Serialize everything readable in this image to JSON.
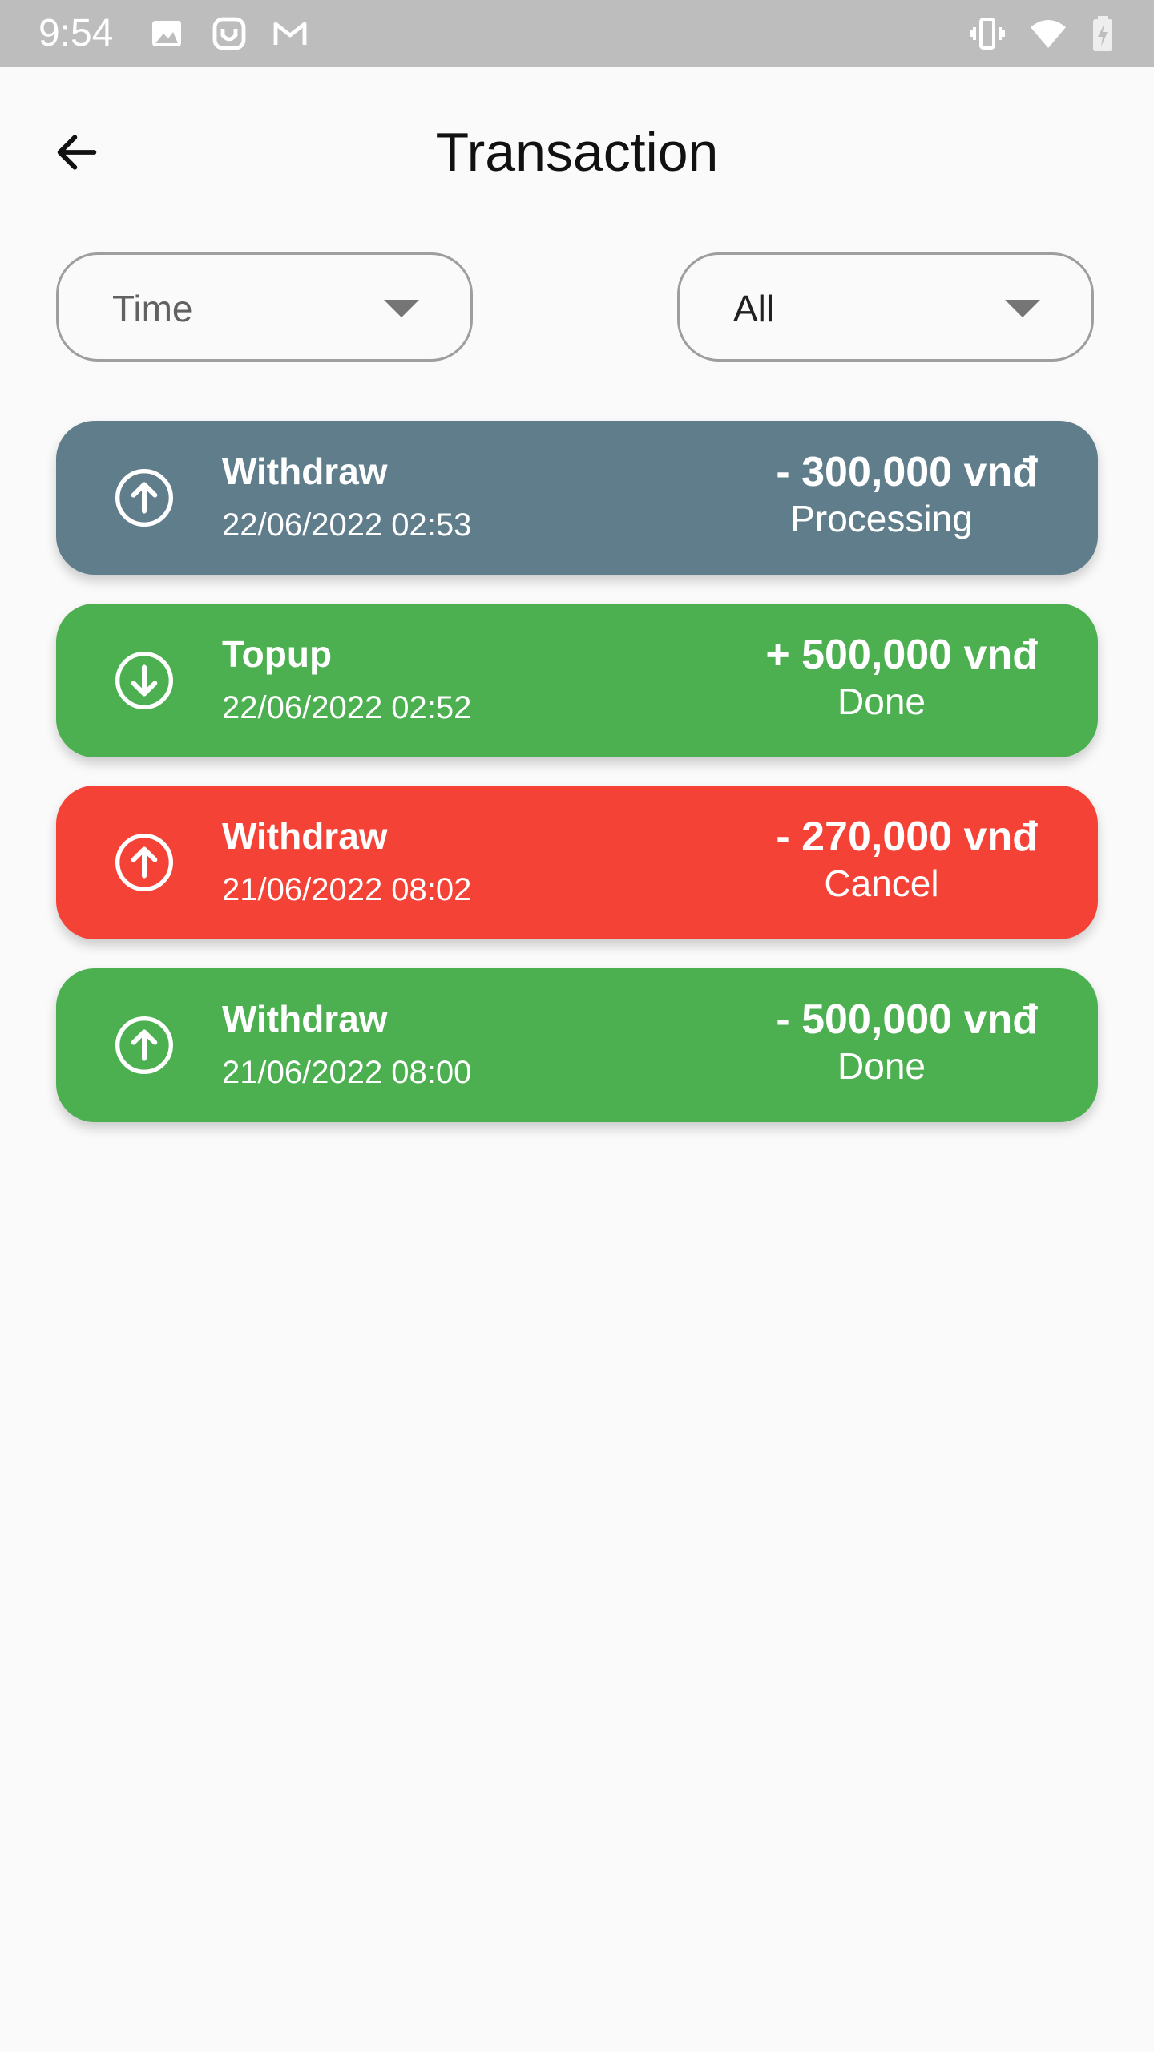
{
  "status_bar": {
    "time": "9:54",
    "left_icons": [
      "image-icon",
      "notification-app-icon",
      "gmail-icon"
    ],
    "right_icons": [
      "vibrate-icon",
      "wifi-icon",
      "battery-charging-icon"
    ],
    "background": "#bdbdbd"
  },
  "header": {
    "title": "Transaction",
    "back_icon": "arrow-left-icon"
  },
  "filters": {
    "time": {
      "selected": "Time"
    },
    "type": {
      "selected": "All"
    }
  },
  "colors": {
    "processing": "#607d8b",
    "done": "#4caf50",
    "cancel": "#f44336"
  },
  "transactions": [
    {
      "type": "Withdraw",
      "date": "22/06/2022 02:53",
      "amount": "- 300,000 vnđ",
      "status": "Processing",
      "icon": "arrow-up-circle-icon",
      "color": "#607d8b"
    },
    {
      "type": "Topup",
      "date": "22/06/2022 02:52",
      "amount": "+ 500,000 vnđ",
      "status": "Done",
      "icon": "arrow-down-circle-icon",
      "color": "#4caf50"
    },
    {
      "type": "Withdraw",
      "date": "21/06/2022 08:02",
      "amount": "- 270,000 vnđ",
      "status": "Cancel",
      "icon": "arrow-up-circle-icon",
      "color": "#f44336"
    },
    {
      "type": "Withdraw",
      "date": "21/06/2022 08:00",
      "amount": "- 500,000 vnđ",
      "status": "Done",
      "icon": "arrow-up-circle-icon",
      "color": "#4caf50"
    }
  ]
}
